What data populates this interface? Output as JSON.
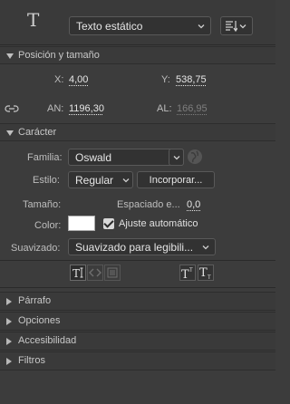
{
  "header": {
    "tool_glyph": "T",
    "text_type": "Texto estático",
    "orientation_icon": "text-orientation-icon"
  },
  "position_size": {
    "title": "Posición y tamaño",
    "x_label": "X:",
    "x_value": "4,00",
    "y_label": "Y:",
    "y_value": "538,75",
    "w_label": "AN:",
    "w_value": "1196,30",
    "h_label": "AL:",
    "h_value": "166,95",
    "link_icon": "link-icon"
  },
  "character": {
    "title": "Carácter",
    "family_label": "Familia:",
    "family_value": "Oswald",
    "style_label": "Estilo:",
    "style_value": "Regular",
    "embed_button": "Incorporar...",
    "size_label": "Tamaño:",
    "spacing_label": "Espaciado e...",
    "spacing_value": "0,0",
    "color_label": "Color:",
    "color_value": "#ffffff",
    "auto_kern_label": "Ajuste automático",
    "auto_kern_checked": true,
    "smoothing_label": "Suavizado:",
    "smoothing_value": "Suavizado para legibili..."
  },
  "collapsed_sections": [
    "Párrafo",
    "Opciones",
    "Accesibilidad",
    "Filtros"
  ],
  "colors": {
    "panel_bg": "#3c3c3c",
    "field_bg": "#323232",
    "text": "#e6e6e6"
  }
}
